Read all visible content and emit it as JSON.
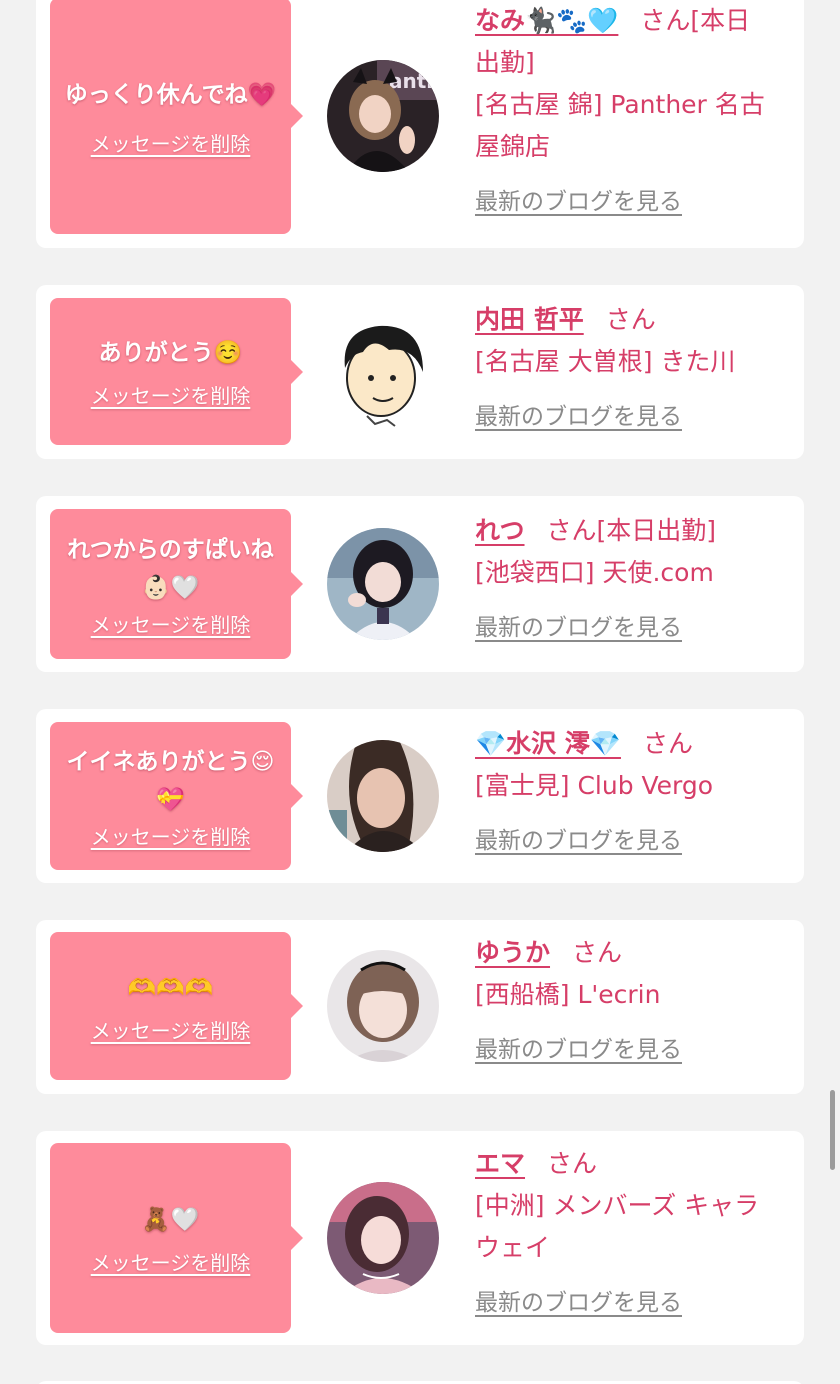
{
  "delete_label": "メッセージを削除",
  "blog_label": "最新のブログを見る",
  "honorific": "さん",
  "colors": {
    "bubble": "#fe8b9b",
    "accent": "#d63e68",
    "link_gray": "#8a8a8a",
    "background": "#f2f2f2"
  },
  "messages": [
    {
      "message": "ゆっくり休んでね💗",
      "name": "なみ🐈‍⬛🐾🩵",
      "status": "[本日出勤]",
      "shop": "[名古屋 錦] Panther 名古屋錦店",
      "avatar": "photo-avatar"
    },
    {
      "message": "ありがとう☺️",
      "name": "内田 哲平",
      "status": "",
      "shop": "[名古屋 大曽根] きた川",
      "avatar": "illustrated-avatar"
    },
    {
      "message": "れつからのすぱいね👶🏻🤍",
      "name": "れつ",
      "status": "[本日出勤]",
      "shop": "[池袋西口] 天使.com",
      "avatar": "photo-avatar"
    },
    {
      "message": "イイネありがとう😌💝",
      "name": "💎水沢 澪💎",
      "status": "",
      "shop": "[富士見] Club Vergo",
      "avatar": "photo-avatar"
    },
    {
      "message": "🫶🫶🫶",
      "name": "ゆうか",
      "status": "",
      "shop": "[西船橋] L'ecrin",
      "avatar": "photo-avatar"
    },
    {
      "message": "🧸🤍",
      "name": "エマ",
      "status": "",
      "shop": "[中洲] メンバーズ キャラウェイ",
      "avatar": "photo-avatar"
    }
  ]
}
